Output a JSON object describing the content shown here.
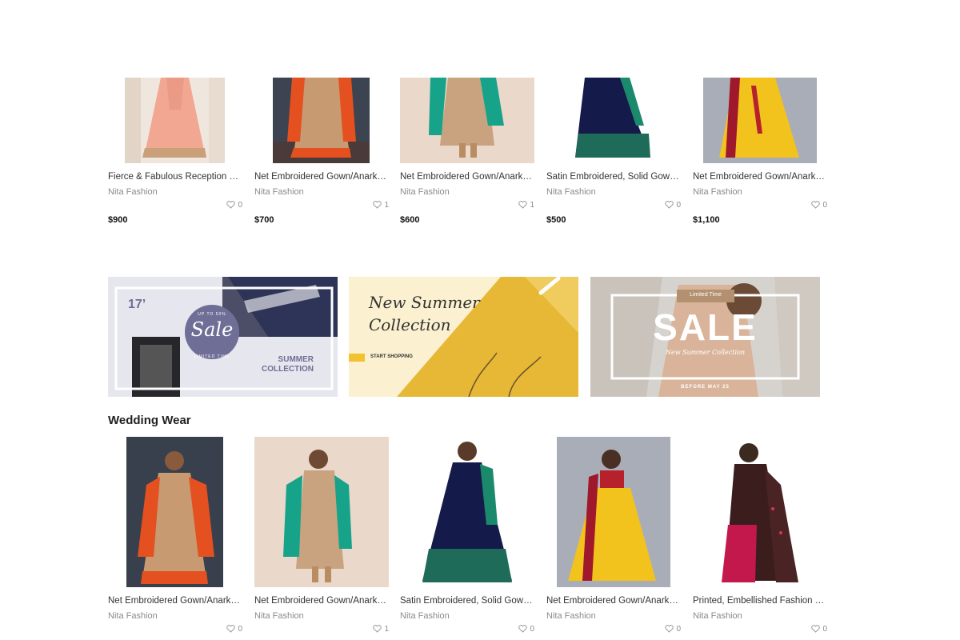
{
  "top_products": [
    {
      "title": "Fierce & Fabulous Reception Fash...",
      "brand": "Nita Fashion",
      "likes": "0",
      "price": "$900"
    },
    {
      "title": "Net Embroidered Gown/Anarkali ...",
      "brand": "Nita Fashion",
      "likes": "1",
      "price": "$700"
    },
    {
      "title": "Net Embroidered Gown/Anarkali ...",
      "brand": "Nita Fashion",
      "likes": "1",
      "price": "$600"
    },
    {
      "title": "Satin Embroidered, Solid Gown/A...",
      "brand": "Nita Fashion",
      "likes": "0",
      "price": "$500"
    },
    {
      "title": "Net Embroidered Gown/Anarkali ...",
      "brand": "Nita Fashion",
      "likes": "0",
      "price": "$1,100"
    }
  ],
  "banners": {
    "b1": {
      "year": "17’",
      "upto": "UP TO 50%",
      "sale": "Sale",
      "limited": "LIMITED TIME",
      "summer": "SUMMER",
      "collection": "COLLECTION"
    },
    "b2": {
      "line1": "New Summer",
      "line2": "Collection",
      "cta": "START SHOPPING"
    },
    "b3": {
      "limited": "Limited Time",
      "sale": "SALE",
      "sub": "New Summer Collection",
      "before": "BEFORE MAY 25"
    }
  },
  "section": {
    "title": "Wedding Wear"
  },
  "wedding_products": [
    {
      "title": "Net Embroidered Gown/Anarkali ...",
      "brand": "Nita Fashion",
      "likes": "0"
    },
    {
      "title": "Net Embroidered Gown/Anarkali ...",
      "brand": "Nita Fashion",
      "likes": "1"
    },
    {
      "title": "Satin Embroidered, Solid Gown/A...",
      "brand": "Nita Fashion",
      "likes": "0"
    },
    {
      "title": "Net Embroidered Gown/Anarkali ...",
      "brand": "Nita Fashion",
      "likes": "0"
    },
    {
      "title": "Printed, Embellished Fashion Lycr...",
      "brand": "Nita Fashion",
      "likes": "0"
    }
  ],
  "colors": {
    "accent_yellow": "#f2c230",
    "banner_purple": "#6f6e96",
    "text_dark": "#222222",
    "muted": "#8a8a8a"
  }
}
